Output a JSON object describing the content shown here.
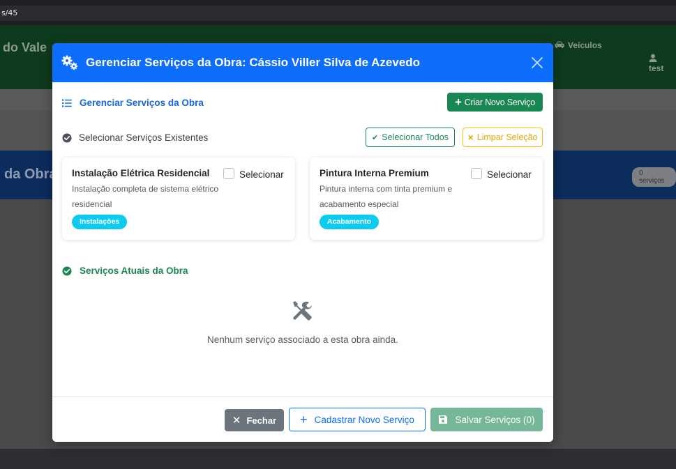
{
  "browser": {
    "url_fragment": "s/45"
  },
  "background": {
    "brand": "do Vale",
    "nav_vehicles": "Veículos",
    "nav_user": "test",
    "hero_title": "da Obra",
    "hero_badge": "0 serviços"
  },
  "modal": {
    "title": "Gerenciar Serviços da Obra: Cássio Viller Silva de Azevedo",
    "header_color": "#0d6efd",
    "section_manage": {
      "title": "Gerenciar Serviços da Obra",
      "create_button": "Criar Novo Serviço"
    },
    "section_select": {
      "title": "Selecionar Serviços Existentes",
      "select_all_button": "Selecionar Todos",
      "clear_button": "Limpar Seleção"
    },
    "services": [
      {
        "name": "Instalação Elétrica Residencial",
        "select_label": "Selecionar",
        "checked": false,
        "description": "Instalação completa de sistema elétrico residencial",
        "category": "Instalações"
      },
      {
        "name": "Pintura Interna Premium",
        "select_label": "Selecionar",
        "checked": false,
        "description": "Pintura interna com tinta premium e acabamento especial",
        "category": "Acabamento"
      }
    ],
    "section_current": {
      "title": "Serviços Atuais da Obra",
      "empty_icon": "tools-icon",
      "empty_text": "Nenhum serviço associado a esta obra ainda."
    },
    "footer": {
      "close_button": "Fechar",
      "register_button": "Cadastrar Novo Serviço",
      "save_button": "Salvar Serviços (0)"
    }
  }
}
